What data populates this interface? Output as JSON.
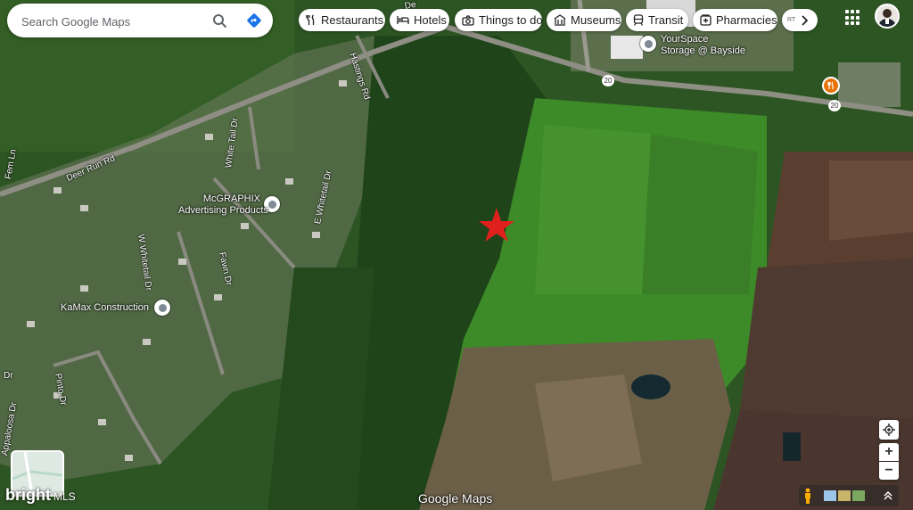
{
  "search": {
    "placeholder": "Search Google Maps"
  },
  "categories": [
    {
      "label": "Restaurants",
      "icon": "fork-knife-icon"
    },
    {
      "label": "Hotels",
      "icon": "bed-icon"
    },
    {
      "label": "Things to do",
      "icon": "camera-icon"
    },
    {
      "label": "Museums",
      "icon": "museum-icon"
    },
    {
      "label": "Transit",
      "icon": "train-icon"
    },
    {
      "label": "Pharmacies",
      "icon": "pharmacy-icon"
    }
  ],
  "places": {
    "yourspace_line1": "YourSpace",
    "yourspace_line2": "Storage @ Bayside",
    "mcgraphix_line1": "McGRAPHIX",
    "mcgraphix_line2": "Advertising Products",
    "kamax": "KaMax Construction"
  },
  "roads": {
    "deer_run": "Deer Run Rd",
    "hastings": "Hastings Rd",
    "white_tail": "White Tail Dr",
    "e_whitetail": "E Whitetail Dr",
    "w_whitetail": "W Whitetail Dr",
    "fawn": "Fawn Dr",
    "pinto": "Pinto Dr",
    "appaloosa": "Appaloosa Dr",
    "route_shield": "20",
    "partial_top": "De",
    "partial_left": "Fem Ln",
    "partial_dr": "Dr"
  },
  "branding": {
    "google_maps": "Google Maps",
    "watermark": "bright",
    "watermark_sub": "MLS"
  },
  "controls": {
    "zoom_in": "+",
    "zoom_out": "−"
  },
  "colors": {
    "marker": "#e0201c",
    "pin_orange": "#e8710a",
    "accent": "#1a73e8"
  }
}
